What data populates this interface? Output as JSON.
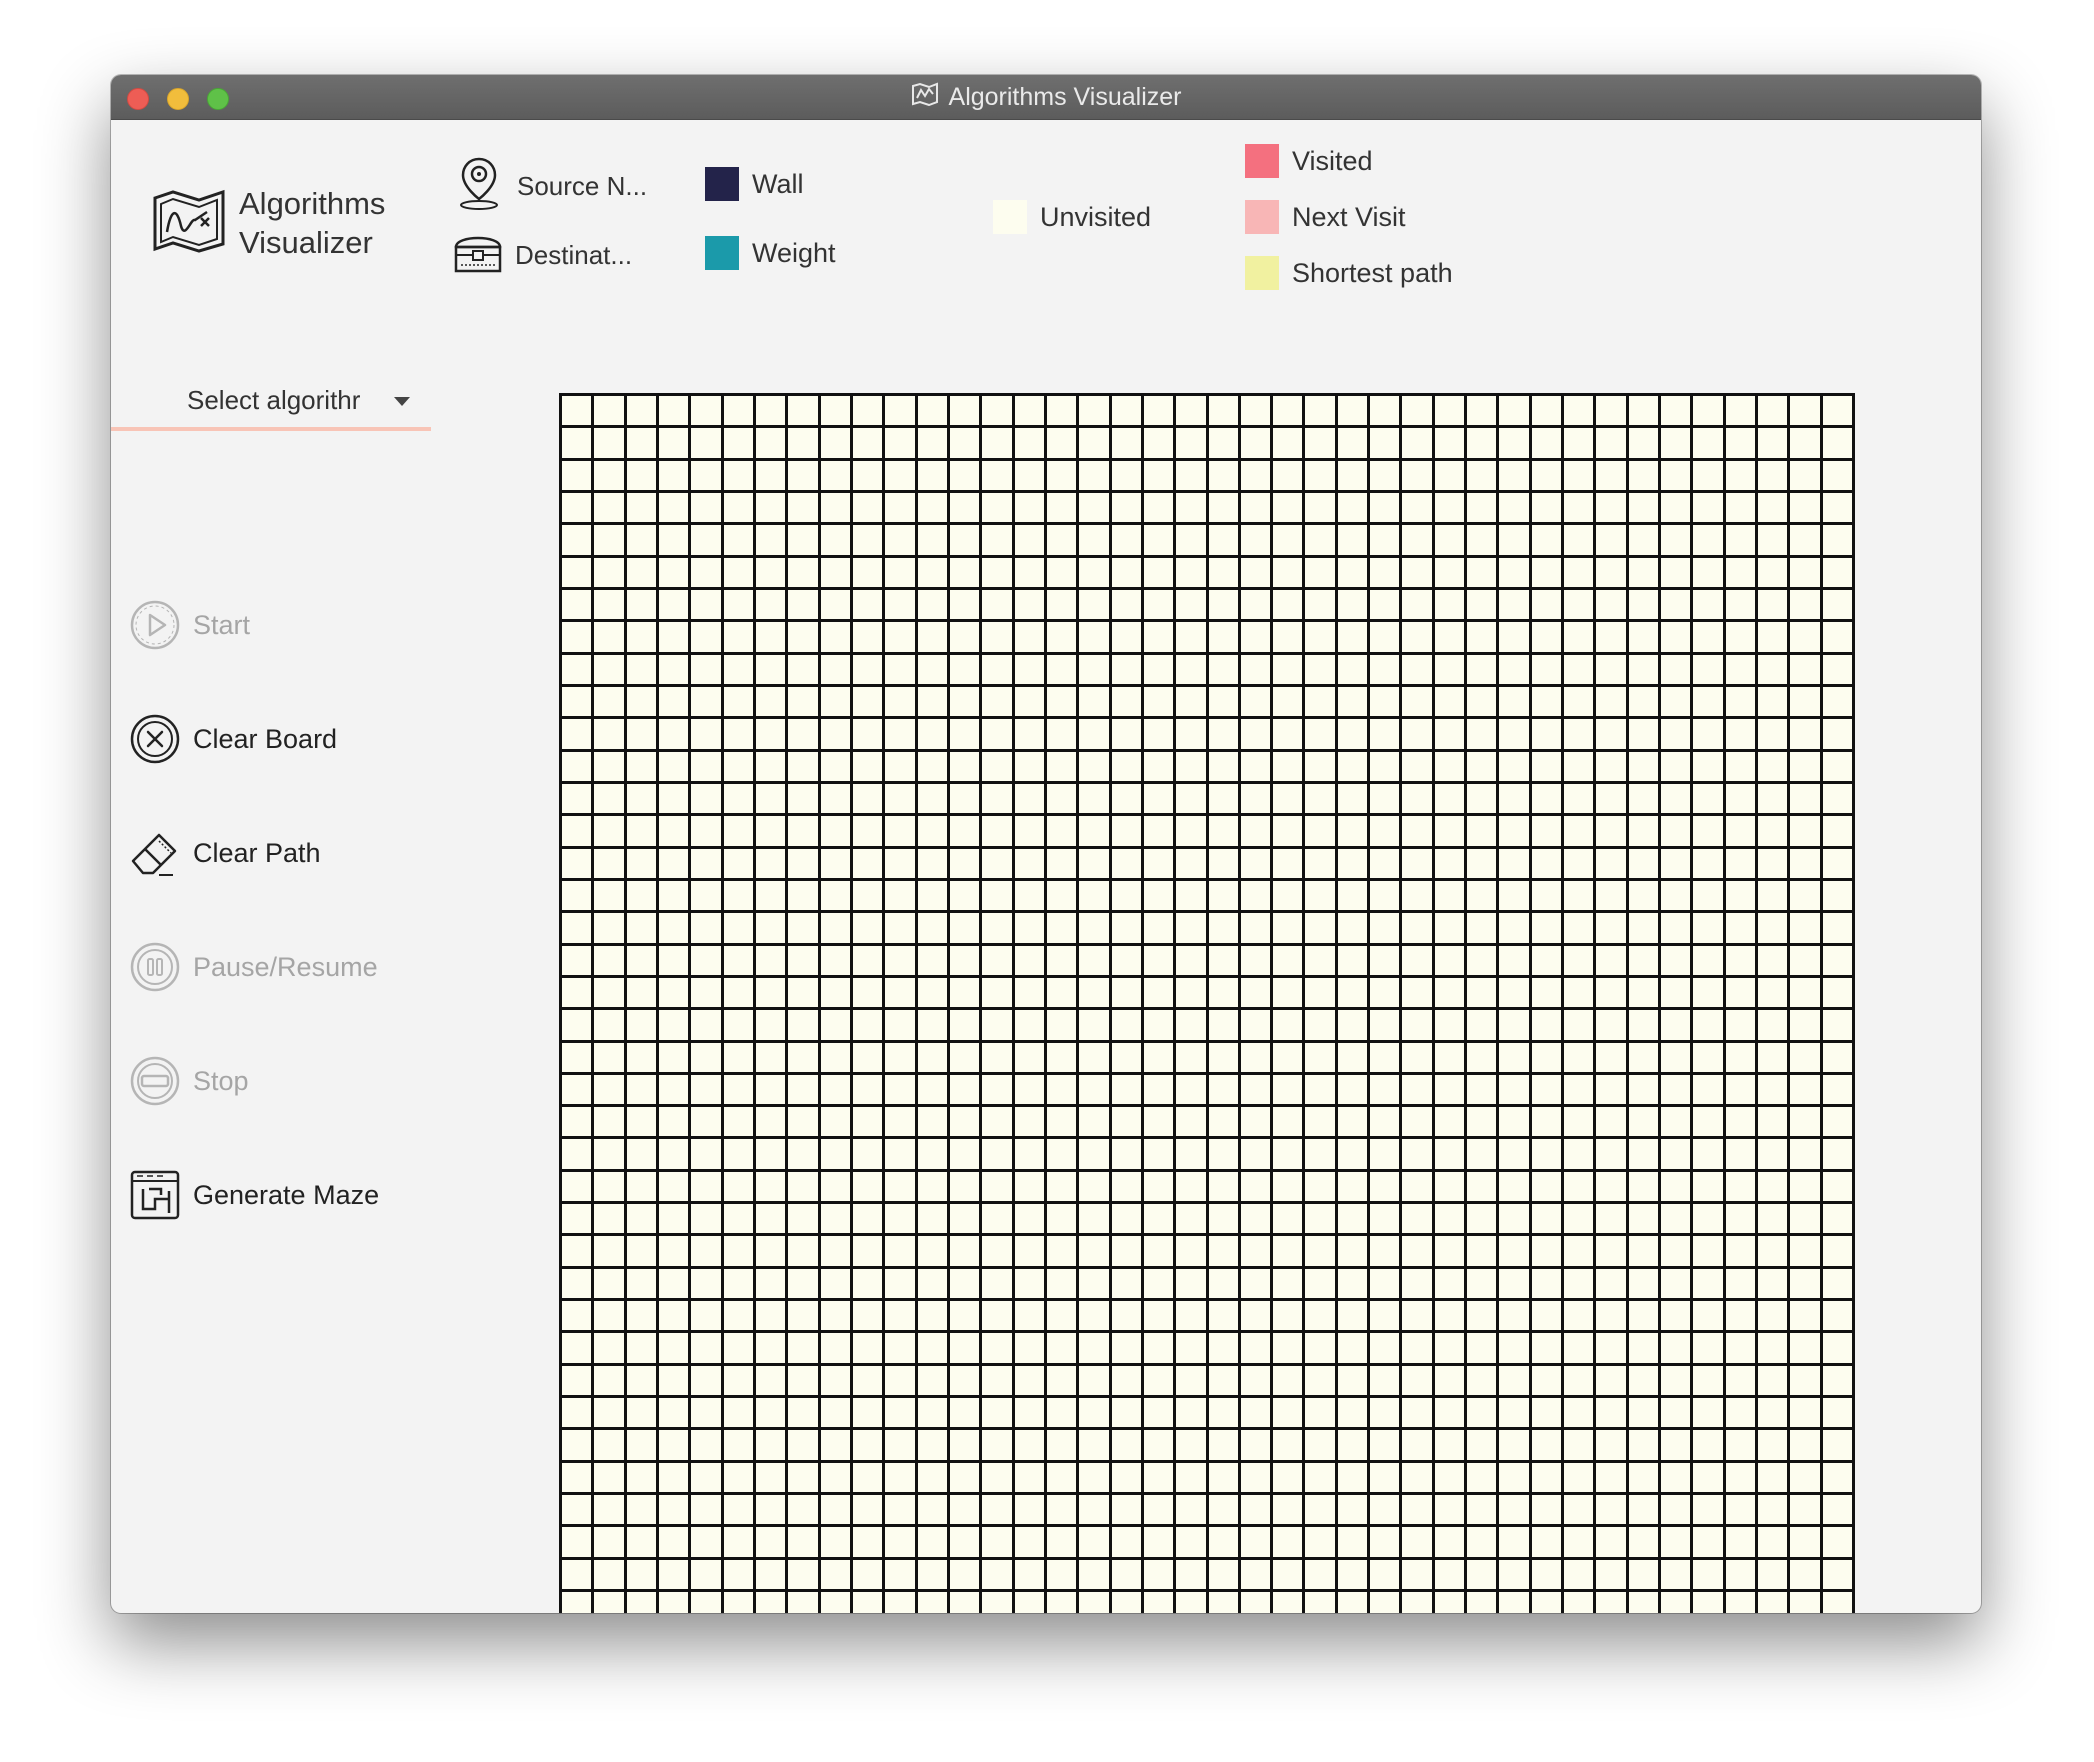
{
  "window": {
    "title": "Algorithms Visualizer",
    "title_icon": "map-icon"
  },
  "logo": {
    "icon": "map-chart-icon",
    "line1": "Algorithms",
    "line2": "Visualizer"
  },
  "nodes": {
    "source": {
      "label": "Source N...",
      "icon": "location-pin-icon"
    },
    "destination": {
      "label": "Destinat...",
      "icon": "treasure-chest-icon"
    }
  },
  "legend": [
    {
      "label": "Wall",
      "color": "#23234a"
    },
    {
      "label": "Weight",
      "color": "#1b9aaa"
    },
    {
      "label": "Unvisited",
      "color": "#fdfdef"
    },
    {
      "label": "Visited",
      "color": "#f4707f"
    },
    {
      "label": "Next Visit",
      "color": "#f8b6b6"
    },
    {
      "label": "Shortest path",
      "color": "#f1f1a0"
    }
  ],
  "algorithm_select": {
    "placeholder": "Select algorithr",
    "accent": "#f8c4b6"
  },
  "actions": [
    {
      "label": "Start",
      "icon": "play-icon",
      "enabled": false
    },
    {
      "label": "Clear Board",
      "icon": "close-circle-icon",
      "enabled": true
    },
    {
      "label": "Clear Path",
      "icon": "eraser-icon",
      "enabled": true
    },
    {
      "label": "Pause/Resume",
      "icon": "pause-icon",
      "enabled": false
    },
    {
      "label": "Stop",
      "icon": "stop-icon",
      "enabled": false
    },
    {
      "label": "Generate Maze",
      "icon": "maze-icon",
      "enabled": true
    }
  ],
  "grid": {
    "rows": 40,
    "columns": 40,
    "cell_color": "#fdfdef",
    "line_color": "#111111"
  }
}
